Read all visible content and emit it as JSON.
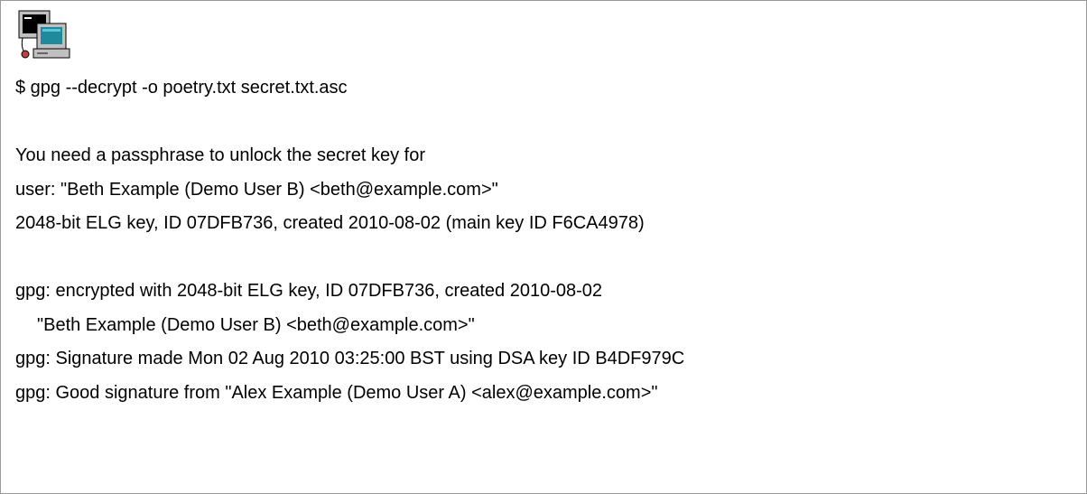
{
  "app_icon": "terminal-computer-icon",
  "terminal": {
    "command": "$ gpg --decrypt -o poetry.txt secret.txt.asc",
    "lines": [
      "You need a passphrase to unlock the secret key for",
      "user: \"Beth Example (Demo User B) <beth@example.com>\"",
      "2048-bit ELG key, ID 07DFB736, created 2010-08-02 (main key ID F6CA4978)",
      "",
      "gpg: encrypted with 2048-bit ELG key, ID 07DFB736, created 2010-08-02",
      "\"Beth Example (Demo User B) <beth@example.com>\"",
      "gpg: Signature made Mon 02 Aug 2010 03:25:00 BST using DSA key ID B4DF979C",
      "gpg: Good signature from \"Alex Example (Demo User A) <alex@example.com>\""
    ]
  }
}
